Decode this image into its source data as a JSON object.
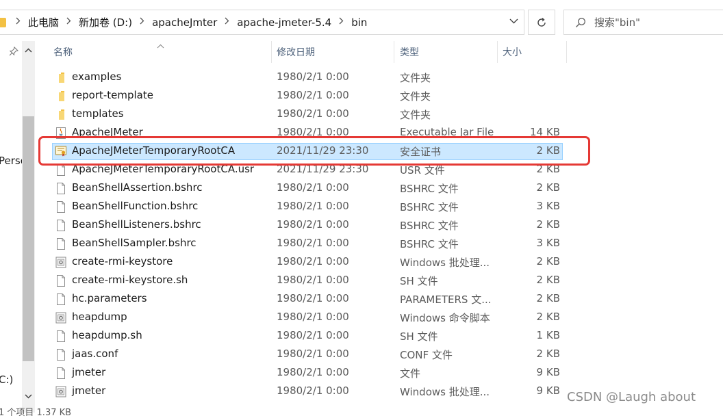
{
  "address_bar": {
    "breadcrumbs": [
      "此电脑",
      "新加卷 (D:)",
      "apacheJmter",
      "apache-jmeter-5.4",
      "bin"
    ]
  },
  "search": {
    "placeholder": "搜索\"bin\""
  },
  "nav_pane": {
    "items": [
      "Perso",
      "C:)"
    ]
  },
  "columns": {
    "name": "名称",
    "date": "修改日期",
    "type": "类型",
    "size": "大小"
  },
  "files": [
    {
      "name": "examples",
      "date": "1980/2/1 0:00",
      "type": "文件夹",
      "size": "",
      "icon": "folder-icon"
    },
    {
      "name": "report-template",
      "date": "1980/2/1 0:00",
      "type": "文件夹",
      "size": "",
      "icon": "folder-icon"
    },
    {
      "name": "templates",
      "date": "1980/2/1 0:00",
      "type": "文件夹",
      "size": "",
      "icon": "folder-icon"
    },
    {
      "name": "ApacheJMeter",
      "date": "1980/2/1 0:00",
      "type": "Executable Jar File",
      "size": "14 KB",
      "icon": "java-jar-icon"
    },
    {
      "name": "ApacheJMeterTemporaryRootCA",
      "date": "2021/11/29 23:30",
      "type": "安全证书",
      "size": "2 KB",
      "icon": "certificate-icon",
      "selected": true
    },
    {
      "name": "ApacheJMeterTemporaryRootCA.usr",
      "date": "2021/11/29 23:30",
      "type": "USR 文件",
      "size": "2 KB",
      "icon": "file-icon"
    },
    {
      "name": "BeanShellAssertion.bshrc",
      "date": "1980/2/1 0:00",
      "type": "BSHRC 文件",
      "size": "2 KB",
      "icon": "file-icon"
    },
    {
      "name": "BeanShellFunction.bshrc",
      "date": "1980/2/1 0:00",
      "type": "BSHRC 文件",
      "size": "3 KB",
      "icon": "file-icon"
    },
    {
      "name": "BeanShellListeners.bshrc",
      "date": "1980/2/1 0:00",
      "type": "BSHRC 文件",
      "size": "2 KB",
      "icon": "file-icon"
    },
    {
      "name": "BeanShellSampler.bshrc",
      "date": "1980/2/1 0:00",
      "type": "BSHRC 文件",
      "size": "3 KB",
      "icon": "file-icon"
    },
    {
      "name": "create-rmi-keystore",
      "date": "1980/2/1 0:00",
      "type": "Windows 批处理...",
      "size": "2 KB",
      "icon": "batch-file-icon"
    },
    {
      "name": "create-rmi-keystore.sh",
      "date": "1980/2/1 0:00",
      "type": "SH 文件",
      "size": "2 KB",
      "icon": "file-icon"
    },
    {
      "name": "hc.parameters",
      "date": "1980/2/1 0:00",
      "type": "PARAMETERS 文...",
      "size": "2 KB",
      "icon": "file-icon"
    },
    {
      "name": "heapdump",
      "date": "1980/2/1 0:00",
      "type": "Windows 命令脚本",
      "size": "2 KB",
      "icon": "batch-file-icon"
    },
    {
      "name": "heapdump.sh",
      "date": "1980/2/1 0:00",
      "type": "SH 文件",
      "size": "1 KB",
      "icon": "file-icon"
    },
    {
      "name": "jaas.conf",
      "date": "1980/2/1 0:00",
      "type": "CONF 文件",
      "size": "2 KB",
      "icon": "file-icon"
    },
    {
      "name": "jmeter",
      "date": "1980/2/1 0:00",
      "type": "文件",
      "size": "9 KB",
      "icon": "file-icon"
    },
    {
      "name": "jmeter",
      "date": "1980/2/1 0:00",
      "type": "Windows 批处理...",
      "size": "9 KB",
      "icon": "batch-file-icon"
    }
  ],
  "status_bar": {
    "text": "1 个项目  1.37 KB"
  },
  "watermark": "CSDN @Laugh about",
  "colors": {
    "selection": "#cce8ff",
    "highlight": "#e53935",
    "folder": "#f3c144"
  }
}
